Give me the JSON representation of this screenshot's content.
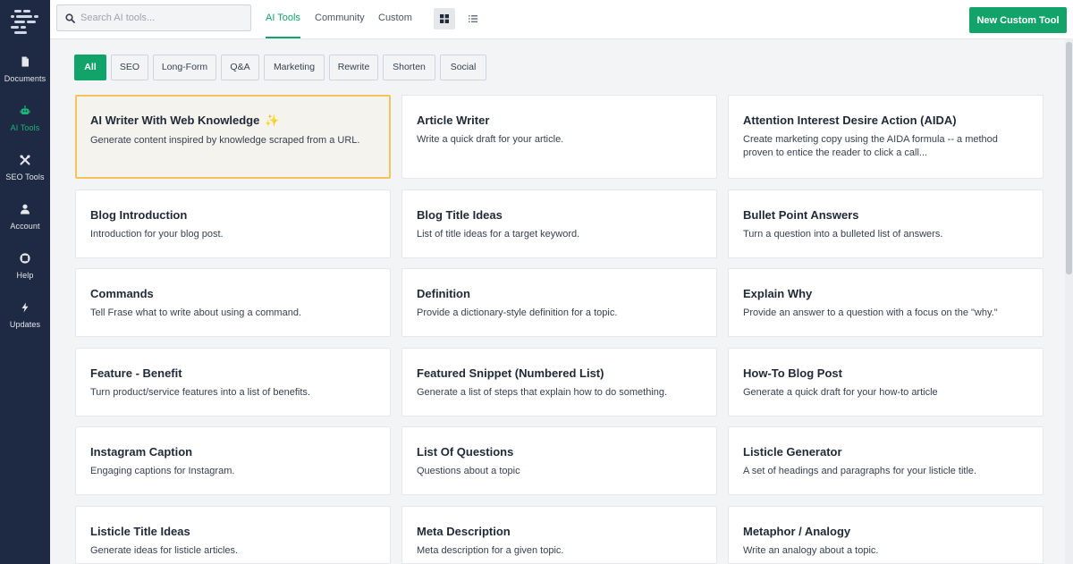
{
  "sidebar": {
    "items": [
      {
        "label": "Documents",
        "icon": "document-icon"
      },
      {
        "label": "AI Tools",
        "icon": "robot-icon"
      },
      {
        "label": "SEO Tools",
        "icon": "tools-icon"
      },
      {
        "label": "Account",
        "icon": "user-icon"
      },
      {
        "label": "Help",
        "icon": "lifebuoy-icon"
      },
      {
        "label": "Updates",
        "icon": "bolt-icon"
      }
    ]
  },
  "search": {
    "placeholder": "Search AI tools..."
  },
  "tabs": [
    {
      "label": "AI Tools"
    },
    {
      "label": "Community"
    },
    {
      "label": "Custom"
    }
  ],
  "toolbar": {
    "new_tool_label": "New Custom Tool"
  },
  "filters": [
    {
      "label": "All"
    },
    {
      "label": "SEO"
    },
    {
      "label": "Long-Form"
    },
    {
      "label": "Q&A"
    },
    {
      "label": "Marketing"
    },
    {
      "label": "Rewrite"
    },
    {
      "label": "Shorten"
    },
    {
      "label": "Social"
    }
  ],
  "cards": [
    {
      "title": "AI Writer With Web Knowledge",
      "sparkle": "✨",
      "desc": "Generate content inspired by knowledge scraped from a URL."
    },
    {
      "title": "Article Writer",
      "desc": "Write a quick draft for your article."
    },
    {
      "title": "Attention Interest Desire Action (AIDA)",
      "desc": "Create marketing copy using the AIDA formula -- a method proven to entice the reader to click a call..."
    },
    {
      "title": "Blog Introduction",
      "desc": "Introduction for your blog post."
    },
    {
      "title": "Blog Title Ideas",
      "desc": "List of title ideas for a target keyword."
    },
    {
      "title": "Bullet Point Answers",
      "desc": "Turn a question into a bulleted list of answers."
    },
    {
      "title": "Commands",
      "desc": "Tell Frase what to write about using a command."
    },
    {
      "title": "Definition",
      "desc": "Provide a dictionary-style definition for a topic."
    },
    {
      "title": "Explain Why",
      "desc": "Provide an answer to a question with a focus on the \"why.\""
    },
    {
      "title": "Feature - Benefit",
      "desc": "Turn product/service features into a list of benefits."
    },
    {
      "title": "Featured Snippet (Numbered List)",
      "desc": "Generate a list of steps that explain how to do something."
    },
    {
      "title": "How-To Blog Post",
      "desc": "Generate a quick draft for your how-to article"
    },
    {
      "title": "Instagram Caption",
      "desc": "Engaging captions for Instagram."
    },
    {
      "title": "List Of Questions",
      "desc": "Questions about a topic"
    },
    {
      "title": "Listicle Generator",
      "desc": "A set of headings and paragraphs for your listicle title."
    },
    {
      "title": "Listicle Title Ideas",
      "desc": "Generate ideas for listicle articles."
    },
    {
      "title": "Meta Description",
      "desc": "Meta description for a given topic."
    },
    {
      "title": "Metaphor / Analogy",
      "desc": "Write an analogy about a topic."
    }
  ],
  "colors": {
    "accent": "#12a36b",
    "sidebar": "#1e2a44",
    "highlight_border": "#f4c35b"
  }
}
